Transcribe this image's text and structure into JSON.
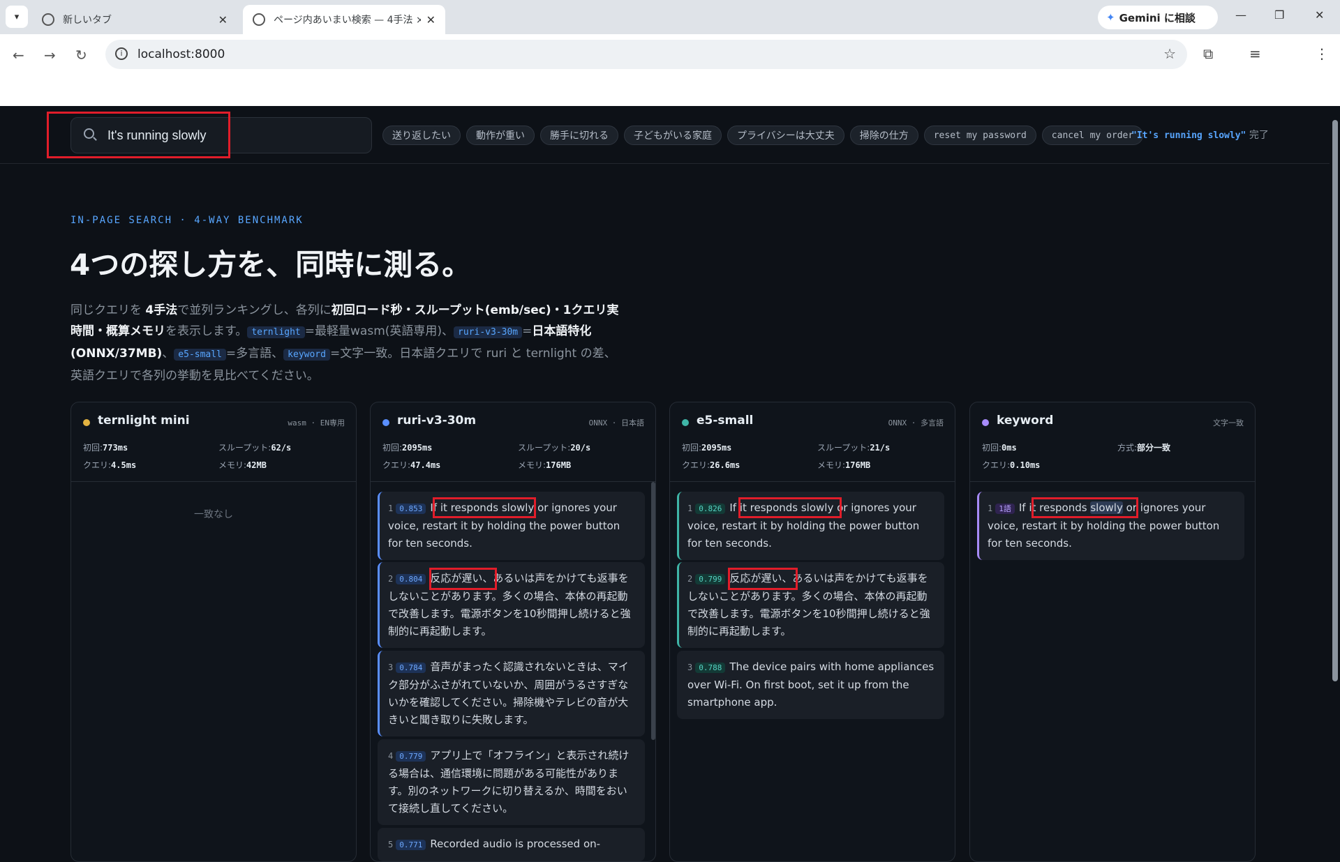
{
  "browser": {
    "tabs": [
      {
        "title": "新しいタブ"
      },
      {
        "title": "ページ内あいまい検索 — 4手法 ×"
      }
    ],
    "gemini_label": "Gemini に相談",
    "url": "localhost:8000"
  },
  "search": {
    "value": "It's running slowly",
    "placeholder": "It's running slowly"
  },
  "chips": [
    "送り返したい",
    "動作が重い",
    "勝手に切れる",
    "子どもがいる家庭",
    "プライバシーは大丈夫",
    "掃除の仕方",
    "reset my password",
    "cancel my order"
  ],
  "status": {
    "query": "\"It's running slowly\"",
    "suffix": "完了"
  },
  "hero": {
    "eyebrow": "IN-PAGE SEARCH · 4-WAY BENCHMARK",
    "title": "4つの探し方を、同時に測る。",
    "desc": {
      "p1": "同じクエリを ",
      "b1": "4手法",
      "p2": "で並列ランキングし、各列に",
      "b2": "初回ロード秒・スループット(emb/sec)・1クエリ実時間・概算メモリ",
      "p3": "を表示します。",
      "c1": "ternlight",
      "p4": "=最軽量wasm(英語専用)、",
      "c2": "ruri-v3-30m",
      "p5": "=",
      "b3": "日本語特化(ONNX/37MB)",
      "p6": "、",
      "c3": "e5-small",
      "p7": "=多言語、",
      "c4": "keyword",
      "p8": "=文字一致。日本語クエリで ruri と ternlight の差、英語クエリで各列の挙動を見比べてください。"
    }
  },
  "columns": [
    {
      "name": "ternlight mini",
      "meta": "wasm · EN専用",
      "color": "#e3b341",
      "stats": [
        [
          "初回:",
          "773ms"
        ],
        [
          "スループット:",
          "62/s"
        ],
        [
          "クエリ:",
          "4.5ms"
        ],
        [
          "メモリ:",
          "42MB"
        ]
      ],
      "empty": "一致なし"
    },
    {
      "name": "ruri-v3-30m",
      "meta": "ONNX · 日本語",
      "color": "#5a8fff",
      "stats": [
        [
          "初回:",
          "2095ms"
        ],
        [
          "スループット:",
          "20/s"
        ],
        [
          "クエリ:",
          "47.4ms"
        ],
        [
          "メモリ:",
          "176MB"
        ]
      ],
      "results": [
        {
          "rank": "1",
          "score": "0.853",
          "pre": "If ",
          "mark": "it responds slowly",
          "post": " or ignores your voice, restart it by holding the power button for ten seconds."
        },
        {
          "rank": "2",
          "score": "0.804",
          "pre": "",
          "mark": "反応が遅い",
          "post": "、あるいは声をかけても返事をしないことがあります。多くの場合、本体の再起動で改善します。電源ボタンを10秒間押し続けると強制的に再起動します。"
        },
        {
          "rank": "3",
          "score": "0.784",
          "pre": "",
          "mark": "",
          "post": "音声がまったく認識されないときは、マイク部分がふさがれていないか、周囲がうるさすぎないかを確認してください。掃除機やテレビの音が大きいと聞き取りに失敗します。"
        },
        {
          "rank": "4",
          "score": "0.779",
          "pre": "",
          "mark": "",
          "post": "アプリ上で「オフライン」と表示され続ける場合は、通信環境に問題がある可能性があります。別のネットワークに切り替えるか、時間をおいて接続し直してください。"
        },
        {
          "rank": "5",
          "score": "0.771",
          "pre": "",
          "mark": "",
          "post": "Recorded audio is processed on-"
        }
      ]
    },
    {
      "name": "e5-small",
      "meta": "ONNX · 多言語",
      "color": "#3fb6a8",
      "stats": [
        [
          "初回:",
          "2095ms"
        ],
        [
          "スループット:",
          "21/s"
        ],
        [
          "クエリ:",
          "26.6ms"
        ],
        [
          "メモリ:",
          "176MB"
        ]
      ],
      "results": [
        {
          "rank": "1",
          "score": "0.826",
          "pre": "If ",
          "mark": "it responds slowly",
          "post": " or ignores your voice, restart it by holding the power button for ten seconds."
        },
        {
          "rank": "2",
          "score": "0.799",
          "pre": "",
          "mark": "反応が遅い",
          "post": "、あるいは声をかけても返事をしないことがあります。多くの場合、本体の再起動で改善します。電源ボタンを10秒間押し続けると強制的に再起動します。"
        },
        {
          "rank": "3",
          "score": "0.788",
          "pre": "",
          "mark": "",
          "post": "The device pairs with home appliances over Wi-Fi. On first boot, set it up from the smartphone app."
        }
      ]
    },
    {
      "name": "keyword",
      "meta": "文字一致",
      "color": "#a78bfa",
      "stats": [
        [
          "初回:",
          "0ms"
        ],
        [
          "方式:",
          "部分一致"
        ],
        [
          "クエリ:",
          "0.10ms"
        ]
      ],
      "results": [
        {
          "rank": "1",
          "score": "1語",
          "pre": "If it responds ",
          "mark": "slowly",
          "post": " or ignores your voice, restart it by holding the power button for ten seconds."
        }
      ]
    }
  ]
}
